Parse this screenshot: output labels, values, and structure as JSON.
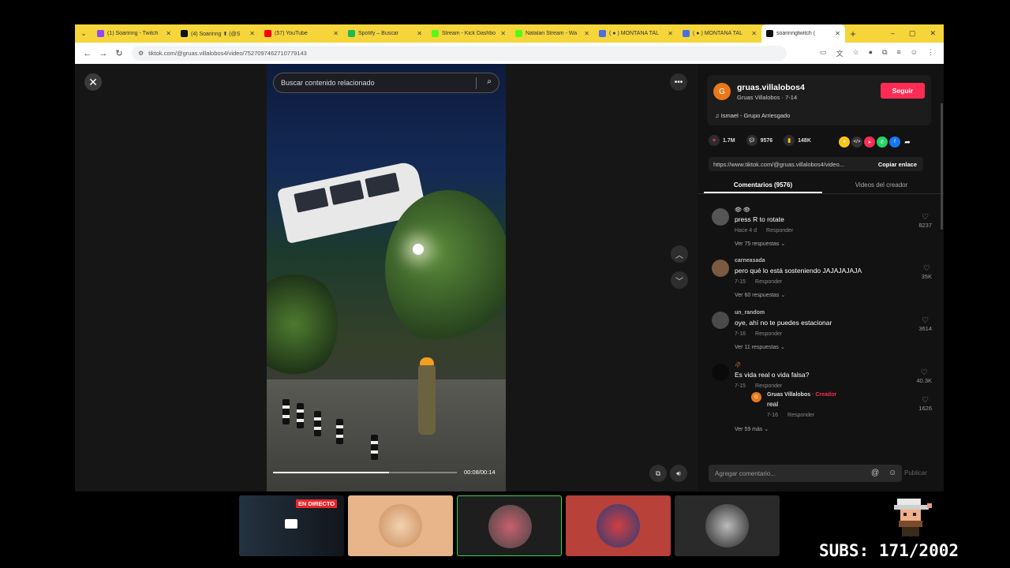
{
  "browser": {
    "tabs": [
      {
        "title": "(1) Soarinng - Twitch",
        "color": "#9146ff"
      },
      {
        "title": "(4) Soarinng ⬆ (@S",
        "color": "#111111"
      },
      {
        "title": "(57) YouTube",
        "color": "#ff0000"
      },
      {
        "title": "Spotify – Buscar",
        "color": "#1db954"
      },
      {
        "title": "Stream - Kick Dashbo",
        "color": "#53fc18"
      },
      {
        "title": "Natalan Stream - Wa",
        "color": "#53fc18"
      },
      {
        "title": "( ● ) MONTAÑA TAL",
        "color": "#4a6ee0"
      },
      {
        "title": "( ● ) MONTAÑA TAL",
        "color": "#4a6ee0"
      },
      {
        "title": "soarinngtwitch (",
        "color": "#111111"
      }
    ],
    "url": "tiktok.com/@gruas.villalobos4/video/7527097462710779143"
  },
  "video": {
    "search_placeholder": "Buscar contenido relacionado",
    "time": "00:08/00:14",
    "progress": 0.63
  },
  "creator": {
    "avatar_letter": "G",
    "handle": "gruas.villalobos4",
    "subtitle": "Gruas Villalobos · 7-14",
    "follow_label": "Seguir",
    "music": "Ismael - Grupo Arriesgado"
  },
  "stats": {
    "likes": "1.7M",
    "comments": "9576",
    "saves": "148K"
  },
  "share": {
    "link": "https://www.tiktok.com/@gruas.villalobos4/video...",
    "copy_label": "Copiar enlace"
  },
  "panel_tabs": {
    "comments": "Comentarios (9576)",
    "creator_videos": "Videos del creador"
  },
  "comments": [
    {
      "user": "👁 👁",
      "text": "press R to rotate",
      "date": "Hace 4 d",
      "reply": "Responder",
      "likes": "8237",
      "replies": "Ver 75 respuestas ⌄"
    },
    {
      "user": "carneasada",
      "text": "pero qué lo está sosteniendo JAJAJAJAJA",
      "date": "7-15",
      "reply": "Responder",
      "likes": "35K",
      "replies": "Ver 60 respuestas ⌄"
    },
    {
      "user": "un_random",
      "text": "oye, ahí no te puedes estacionar",
      "date": "7-16",
      "reply": "Responder",
      "likes": "3614",
      "replies": "Ver 11 respuestas ⌄"
    },
    {
      "user": "🥀",
      "text": "Es vida real o vida falsa?",
      "date": "7-15",
      "reply": "Responder",
      "likes": "40.3K",
      "replies": "Ver 59 más ⌄"
    }
  ],
  "creator_reply": {
    "avatar_letter": "G",
    "user": "Gruas Villalobos",
    "tag": "· Creador",
    "text": "real",
    "date": "7-16",
    "reply": "Responder",
    "likes": "1626"
  },
  "comment_box": {
    "placeholder": "Agregar comentario...",
    "publish_label": "Publicar"
  },
  "overlay": {
    "live_label": "EN DIRECTO",
    "subs": "SUBS: 171/2002"
  }
}
